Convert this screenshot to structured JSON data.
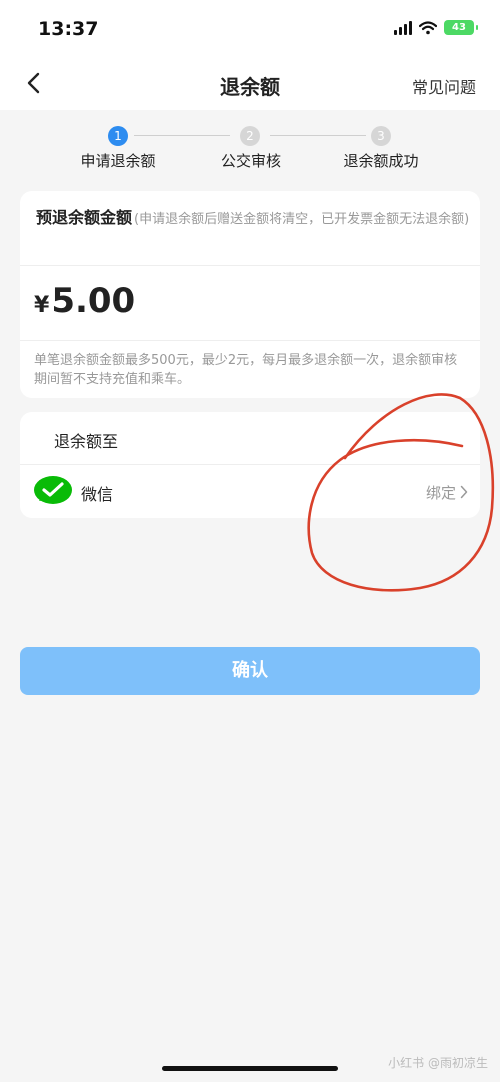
{
  "status_bar": {
    "time": "13:37",
    "battery": "43"
  },
  "nav": {
    "title": "退余额",
    "faq": "常见问题"
  },
  "steps": [
    {
      "number": "1",
      "label": "申请退余额",
      "active": true
    },
    {
      "number": "2",
      "label": "公交审核",
      "active": false
    },
    {
      "number": "3",
      "label": "退余额成功",
      "active": false
    }
  ],
  "amount_card": {
    "title": "预退余额金额",
    "hint": "(申请退余额后赠送金额将清空，已开发票金额无法退余额)",
    "currency": "¥",
    "amount": "5.00",
    "note": "单笔退余额金额最多500元，最少2元，每月最多退余额一次，退余额审核期间暂不支持充值和乘车。"
  },
  "destination": {
    "title": "退余额至",
    "method_icon": "wechat-icon",
    "method_label": "微信",
    "bind_label": "绑定"
  },
  "confirm_label": "确认",
  "watermark": "小红书 @雨初凉生",
  "colors": {
    "accent": "#2d8cf0",
    "button": "#7ec0fa",
    "wechat": "#09bb07",
    "annotation": "#d9412b",
    "battery": "#4cd964"
  }
}
